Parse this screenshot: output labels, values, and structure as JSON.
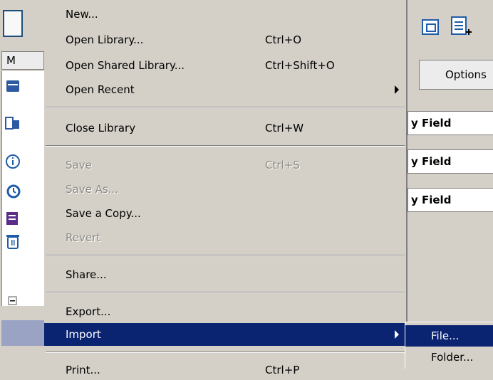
{
  "background": {
    "tab_label": "M",
    "options_label": "Options",
    "field_labels": [
      "y Field",
      "y Field",
      "y Field"
    ],
    "side_icons": [
      "library-icon",
      "copy-icon",
      "info-icon",
      "history-icon",
      "list-icon",
      "trash-icon"
    ],
    "toolbar_icons": [
      "document-icon",
      "window-icon",
      "add-list-icon"
    ]
  },
  "menu": {
    "items": [
      {
        "label": "New...",
        "shortcut": ""
      },
      {
        "label": "Open Library...",
        "shortcut": "Ctrl+O"
      },
      {
        "label": "Open Shared Library...",
        "shortcut": "Ctrl+Shift+O"
      },
      {
        "label": "Open Recent",
        "shortcut": "",
        "submenu": true
      },
      {
        "label": "Close Library",
        "shortcut": "Ctrl+W"
      },
      {
        "label": "Save",
        "shortcut": "Ctrl+S",
        "disabled": true
      },
      {
        "label": "Save As...",
        "shortcut": "",
        "disabled": true
      },
      {
        "label": "Save a Copy...",
        "shortcut": ""
      },
      {
        "label": "Revert",
        "shortcut": "",
        "disabled": true
      },
      {
        "label": "Share...",
        "shortcut": ""
      },
      {
        "label": "Export...",
        "shortcut": ""
      },
      {
        "label": "Import",
        "shortcut": "",
        "submenu": true,
        "highlighted": true
      },
      {
        "label": "Print...",
        "shortcut": "Ctrl+P"
      }
    ]
  },
  "submenu": {
    "items": [
      {
        "label": "File...",
        "highlighted": true
      },
      {
        "label": "Folder..."
      }
    ]
  },
  "colors": {
    "highlight": "#0b2472",
    "menu_bg": "#d4d0c8",
    "disabled_text": "#8c8a84"
  }
}
